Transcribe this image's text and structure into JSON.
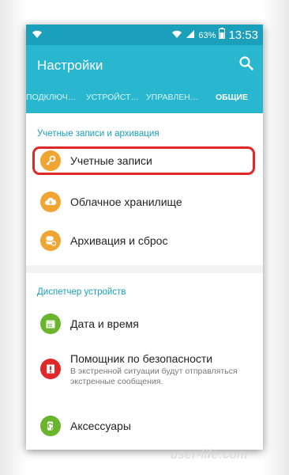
{
  "status": {
    "battery_pct": "63%",
    "time": "13:53"
  },
  "appbar": {
    "title": "Настройки"
  },
  "tabs": [
    {
      "label": "ПОДКЛЮЧ…"
    },
    {
      "label": "УСТРОЙСТ…"
    },
    {
      "label": "УПРАВЛЕН…"
    },
    {
      "label": "ОБЩИЕ"
    }
  ],
  "sections": [
    {
      "header": "Учетные записи и архивация",
      "items": [
        {
          "title": "Учетные записи",
          "icon": "key-icon",
          "color": "#f0a431"
        },
        {
          "title": "Облачное хранилище",
          "icon": "cloud-icon",
          "color": "#f0a431"
        },
        {
          "title": "Архивация и сброс",
          "icon": "backup-icon",
          "color": "#f0a431"
        }
      ]
    },
    {
      "header": "Диспетчер устройств",
      "items": [
        {
          "title": "Дата и время",
          "icon": "calendar-icon",
          "color": "#6ab42e"
        },
        {
          "title": "Помощник по безопасности",
          "subtitle": "В экстренной ситуации будут отправляться экстренные сообщения.",
          "icon": "alert-icon",
          "color": "#e02828"
        },
        {
          "title": "Аксессуары",
          "icon": "accessory-icon",
          "color": "#6ab42e"
        }
      ]
    }
  ],
  "watermark": "user-life.com",
  "colors": {
    "statusbar": "#1aa0ba",
    "appbar": "#29b6cf",
    "accent": "#1a9fb8",
    "highlight": "#e02828"
  }
}
